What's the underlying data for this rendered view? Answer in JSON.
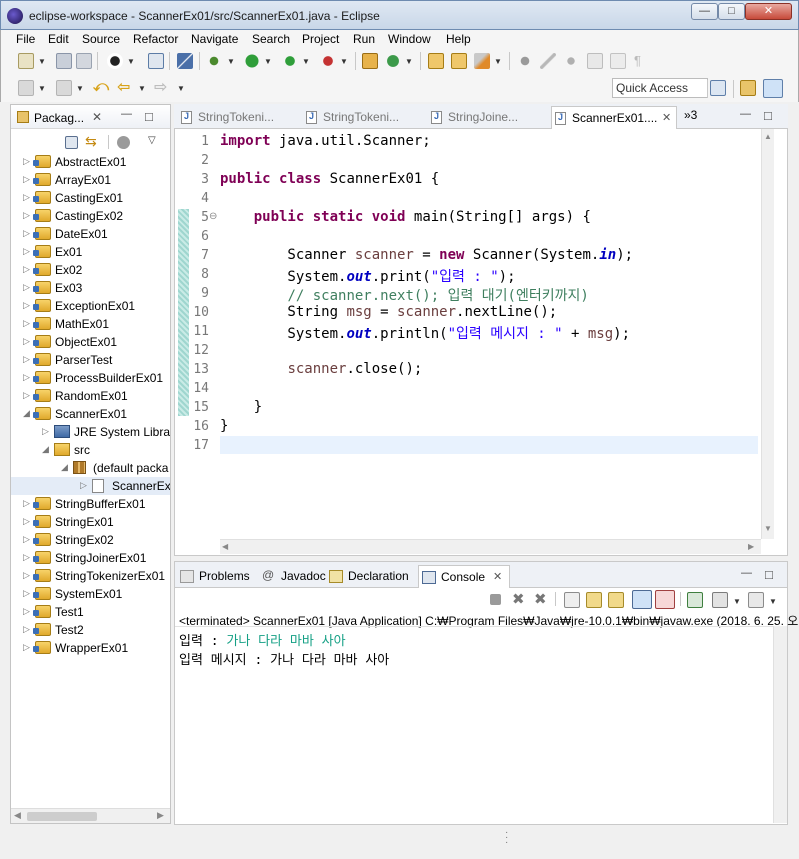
{
  "window": {
    "title": "eclipse-workspace - ScannerEx01/src/ScannerEx01.java - Eclipse",
    "minimize": "—",
    "maximize": "□",
    "close": "✕"
  },
  "menu": [
    "File",
    "Edit",
    "Source",
    "Refactor",
    "Navigate",
    "Search",
    "Project",
    "Run",
    "Window",
    "Help"
  ],
  "toolbar": {
    "quick_access": "Quick Access"
  },
  "package_explorer": {
    "title": "Packag...",
    "close": "✕",
    "items": [
      {
        "label": "AbstractEx01"
      },
      {
        "label": "ArrayEx01"
      },
      {
        "label": "CastingEx01"
      },
      {
        "label": "CastingEx02"
      },
      {
        "label": "DateEx01"
      },
      {
        "label": "Ex01"
      },
      {
        "label": "Ex02"
      },
      {
        "label": "Ex03"
      },
      {
        "label": "ExceptionEx01"
      },
      {
        "label": "MathEx01"
      },
      {
        "label": "ObjectEx01"
      },
      {
        "label": "ParserTest"
      },
      {
        "label": "ProcessBuilderEx01"
      },
      {
        "label": "RandomEx01"
      },
      {
        "label": "ScannerEx01"
      },
      {
        "label": "JRE System Librar"
      },
      {
        "label": "src"
      },
      {
        "label": "(default packa"
      },
      {
        "label": "ScannerEx"
      },
      {
        "label": "StringBufferEx01"
      },
      {
        "label": "StringEx01"
      },
      {
        "label": "StringEx02"
      },
      {
        "label": "StringJoinerEx01"
      },
      {
        "label": "StringTokenizerEx01"
      },
      {
        "label": "SystemEx01"
      },
      {
        "label": "Test1"
      },
      {
        "label": "Test2"
      },
      {
        "label": "WrapperEx01"
      }
    ]
  },
  "editor": {
    "tabs": [
      "StringTokeni...",
      "StringTokeni...",
      "StringJoine...",
      "ScannerEx01...."
    ],
    "active_tab_close": "✕",
    "overflow": "»3",
    "line_numbers": [
      "1",
      "2",
      "3",
      "4",
      "5",
      "6",
      "7",
      "8",
      "9",
      "10",
      "11",
      "12",
      "13",
      "14",
      "15",
      "16",
      "17"
    ],
    "fold_marker": "⊖"
  },
  "console": {
    "tabs": [
      "Problems",
      "Javadoc",
      "Declaration",
      "Console"
    ],
    "active_tab_close": "✕",
    "status": "<terminated> ScannerEx01 [Java Application] C:₩Program Files₩Java₩jre-10.0.1₩bin₩javaw.exe (2018. 6. 25. 오",
    "prompt": "입력 : ",
    "input": "가나 다라 마바 사아",
    "output": "입력 메시지 : 가나 다라 마바 사아"
  }
}
